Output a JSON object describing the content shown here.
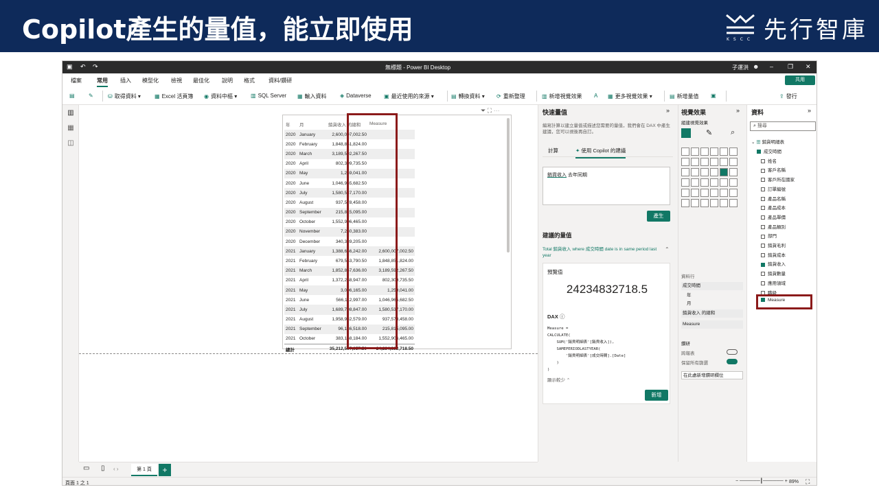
{
  "slide": {
    "title": "Copilot產生的量值，能立即使用",
    "logo_text": "先行智庫",
    "logo_sub": "KSCC"
  },
  "app": {
    "window_title": "無標題 - Power BI Desktop",
    "user": "子運洪",
    "menu": [
      "檔案",
      "常用",
      "插入",
      "模型化",
      "檢視",
      "最佳化",
      "說明",
      "格式",
      "資料/鑽研"
    ],
    "share": "共用",
    "ribbon": {
      "get_data": "取得資料",
      "excel": "Excel 活頁簿",
      "hub": "資料中樞",
      "sql": "SQL Server",
      "enter": "輸入資料",
      "dataverse": "Dataverse",
      "recent": "最近使用的來源",
      "transform": "轉換資料",
      "refresh": "重新整理",
      "new_visual": "新增視覺效果",
      "more_visuals": "更多視覺效果",
      "new_measure": "新增量值",
      "publish": "發行"
    }
  },
  "table": {
    "headers": [
      "年",
      "月",
      "銷貨收入 的總和",
      "Measure"
    ],
    "rows": [
      [
        "2020",
        "January",
        "2,600,007,002.50",
        ""
      ],
      [
        "2020",
        "February",
        "1,848,851,824.00",
        ""
      ],
      [
        "2020",
        "March",
        "3,189,592,267.50",
        ""
      ],
      [
        "2020",
        "April",
        "802,309,735.50",
        ""
      ],
      [
        "2020",
        "May",
        "1,259,041.00",
        ""
      ],
      [
        "2020",
        "June",
        "1,046,965,682.50",
        ""
      ],
      [
        "2020",
        "July",
        "1,580,537,170.00",
        ""
      ],
      [
        "2020",
        "August",
        "937,578,458.00",
        ""
      ],
      [
        "2020",
        "September",
        "215,815,095.00",
        ""
      ],
      [
        "2020",
        "October",
        "1,552,906,465.00",
        ""
      ],
      [
        "2020",
        "November",
        "7,230,383.00",
        ""
      ],
      [
        "2020",
        "December",
        "340,389,205.00",
        ""
      ],
      [
        "2021",
        "January",
        "1,388,656,242.00",
        "2,600,007,002.50"
      ],
      [
        "2021",
        "February",
        "679,553,790.50",
        "1,848,851,824.00"
      ],
      [
        "2021",
        "March",
        "1,852,867,636.00",
        "3,189,592,267.50"
      ],
      [
        "2021",
        "April",
        "1,372,258,947.00",
        "802,309,735.50"
      ],
      [
        "2021",
        "May",
        "3,006,165.00",
        "1,259,041.00"
      ],
      [
        "2021",
        "June",
        "566,112,997.00",
        "1,046,965,682.50"
      ],
      [
        "2021",
        "July",
        "1,689,798,847.00",
        "1,580,537,170.00"
      ],
      [
        "2021",
        "August",
        "1,958,932,579.00",
        "937,578,458.00"
      ],
      [
        "2021",
        "September",
        "96,136,518.00",
        "215,815,095.00"
      ],
      [
        "2021",
        "October",
        "383,168,184.00",
        "1,552,906,465.00"
      ]
    ],
    "total_label": "總計",
    "total_value": "35,212,597,957.50",
    "total_measure": "24,234,832,718.50"
  },
  "copilot": {
    "title": "快速量值",
    "description": "編寫計算以建立量值或描述您需要的量值，我們會在 DAX 中產生建議，您可以視後再自訂。",
    "tab_calc": "計算",
    "tab_copilot": "使用 Copilot 的建議",
    "input_highlight": "銷貨收入",
    "input_rest": " 去年同期",
    "generate": "產生",
    "suggested_title": "建議的量值",
    "suggestion": "Total 銷貨收入 where 成交時間 date is in same period last year",
    "preview_label": "預覽值",
    "preview_value": "24234832718.5",
    "dax_label": "DAX",
    "dax_code": "Measure =\nCALCULATE(\n    SUM('銷貨明細表'[銷貨收入]),\n    SAMEPERIODLASTYEAR(\n        '銷貨明細表'[成交時間].[Date]\n    )\n)",
    "show_less": "顯示較少",
    "add": "新增"
  },
  "viz": {
    "title": "視覺效果",
    "build": "組建視覺效果",
    "rows_label": "資料行",
    "f1": "成交時間",
    "f2": "年",
    "f3": "月",
    "f4": "銷貨收入 的總和",
    "f5": "Measure",
    "drill": "鑽研",
    "cross": "跨報表",
    "keep": "保留所有篩選",
    "drill_add": "在此處新增鑽研欄位"
  },
  "data": {
    "title": "資料",
    "search": "搜尋",
    "table_name": "銷貨明細表",
    "fields": [
      "成交時間",
      "姓名",
      "客戶名稱",
      "客戶所在國家",
      "訂單編號",
      "產品名稱",
      "產品成本",
      "產品單價",
      "產品類別",
      "部門",
      "銷貨毛利",
      "銷貨成本",
      "銷貨收入",
      "銷貨數量",
      "應用領域",
      "職級",
      "Measure"
    ]
  },
  "bottom": {
    "page_tab": "第 1 頁",
    "status": "頁面 1 之 1",
    "zoom": "89%"
  }
}
